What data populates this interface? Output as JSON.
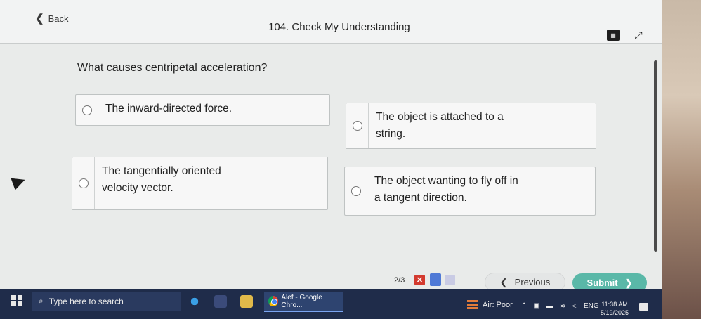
{
  "header": {
    "back_label": "Back",
    "title": "104. Check My Understanding",
    "calculator_icon": "calculator-icon",
    "expand_icon": "expand-icon"
  },
  "question": {
    "text": "What causes centripetal acceleration?"
  },
  "choices": [
    {
      "text": "The inward-directed force."
    },
    {
      "text": "The object is attached to a\nstring."
    },
    {
      "text": "The tangentially oriented\nvelocity vector."
    },
    {
      "text": "The object wanting to fly off in\na tangent direction."
    }
  ],
  "footer": {
    "counter": "2/3",
    "previous_label": "Previous",
    "submit_label": "Submit",
    "status_colors": {
      "incorrect": "#d33a2f",
      "current": "#4f79d6",
      "upcoming": "#c9cbe4"
    },
    "accent": "#5ab8a8"
  },
  "taskbar": {
    "search_placeholder": "Type here to search",
    "chrome_label": "Alef - Google Chro...",
    "air_quality": "Air: Poor",
    "language": "ENG",
    "time": "11:38 AM",
    "date": "5/19/2025"
  }
}
